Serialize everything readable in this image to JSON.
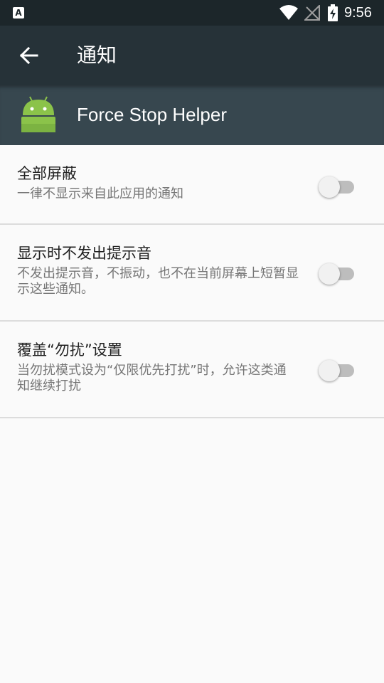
{
  "status_bar": {
    "notification_icon": "text-a-icon",
    "notification_glyph": "A",
    "wifi_icon": "wifi-icon",
    "signal_icon": "no-signal-icon",
    "battery_icon": "battery-charging-icon",
    "time": "9:56"
  },
  "toolbar": {
    "back_icon": "arrow-back-icon",
    "title": "通知"
  },
  "app_header": {
    "icon": "android-icon",
    "app_name": "Force Stop Helper"
  },
  "settings": [
    {
      "title": "全部屏蔽",
      "summary": "一律不显示来自此应用的通知",
      "enabled": false
    },
    {
      "title": "显示时不发出提示音",
      "summary": "不发出提示音，不振动，也不在当前屏幕上短暂显示这些通知。",
      "enabled": false
    },
    {
      "title": "覆盖“勿扰”设置",
      "summary": "当勿扰模式设为“仅限优先打扰”时，允许这类通知继续打扰",
      "enabled": false
    }
  ],
  "colors": {
    "status_bar": "#1c262a",
    "toolbar": "#263238",
    "app_header": "#37474f",
    "android_green": "#8bc34a",
    "background": "#fafafa"
  }
}
